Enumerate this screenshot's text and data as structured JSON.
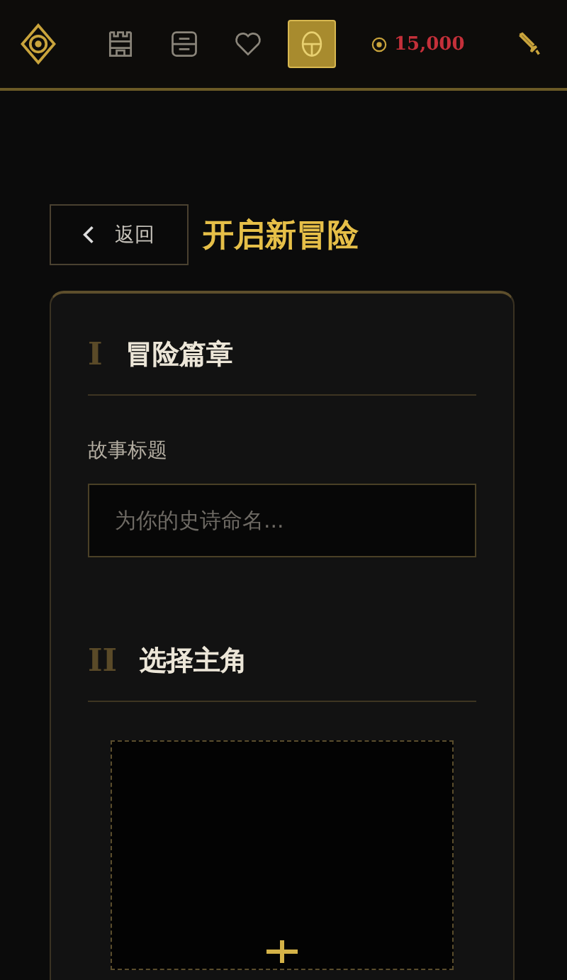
{
  "nav": {
    "items": [
      {
        "kind": "castle",
        "selected": false
      },
      {
        "kind": "scroll",
        "selected": false
      },
      {
        "kind": "heart",
        "selected": false
      },
      {
        "kind": "helmet",
        "selected": true
      }
    ],
    "coins": "15,000"
  },
  "back_button": "返回",
  "title": "开启新冒险",
  "sections": [
    {
      "numeral": "I",
      "title": "冒险篇章"
    },
    {
      "numeral": "II",
      "title": "选择主角"
    }
  ],
  "story_title": {
    "label": "故事标题",
    "placeholder": "为你的史诗命名..."
  }
}
